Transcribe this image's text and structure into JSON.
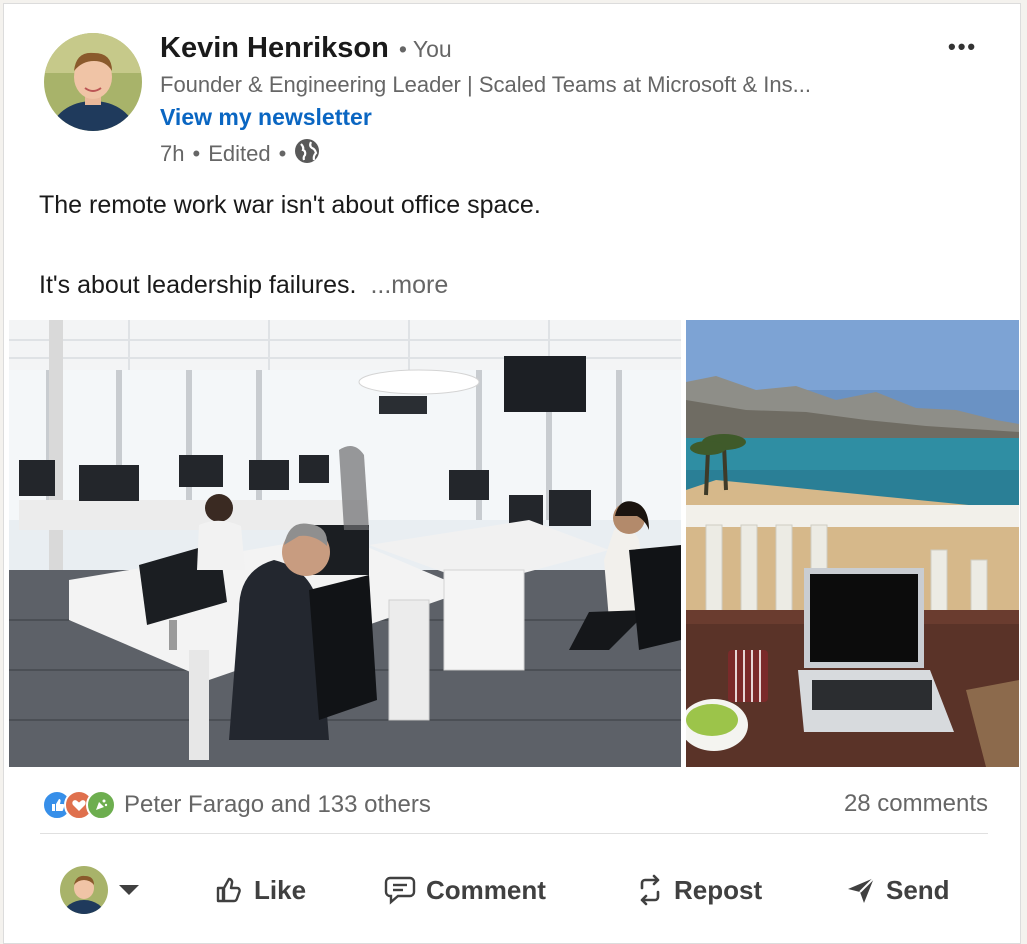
{
  "post": {
    "author_name": "Kevin Henrikson",
    "author_badge": "• You",
    "author_headline": "Founder & Engineering Leader | Scaled Teams at Microsoft & Ins...",
    "newsletter_link": "View my newsletter",
    "time": "7h",
    "sep1": "•",
    "edited": "Edited",
    "sep2": "•",
    "visibility_icon": "globe-icon",
    "menu_icon": "more-options-icon",
    "text_line_1": "The remote work war isn't about office space.",
    "text_line_2": "It's about leadership failures.",
    "see_more": "...more"
  },
  "images": [
    {
      "name": "office-photo",
      "alt": "Open office with people at desks"
    },
    {
      "name": "beach-balcony-photo",
      "alt": "Laptop on balcony overlooking beach"
    }
  ],
  "social": {
    "reaction_icons": [
      "like-reaction-icon",
      "love-reaction-icon",
      "celebrate-reaction-icon"
    ],
    "reactions_text": "Peter Farago and 133 others",
    "comments_text": "28 comments"
  },
  "actions": {
    "like": "Like",
    "comment": "Comment",
    "repost": "Repost",
    "send": "Send"
  },
  "colors": {
    "link_blue": "#0a66c2",
    "text_primary": "#1a1a1a",
    "text_secondary": "#666666"
  }
}
